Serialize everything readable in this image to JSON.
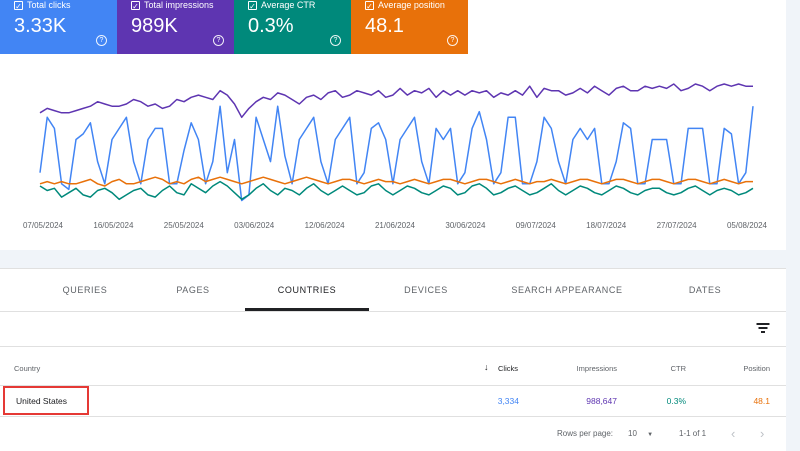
{
  "metrics": [
    {
      "label": "Total clicks",
      "value": "3.33K",
      "color": "#4285f4"
    },
    {
      "label": "Total impressions",
      "value": "989K",
      "color": "#5e35b1"
    },
    {
      "label": "Average CTR",
      "value": "0.3%",
      "color": "#00897b"
    },
    {
      "label": "Average position",
      "value": "48.1",
      "color": "#e8710a"
    }
  ],
  "chart_data": {
    "type": "line",
    "x_tick_labels": [
      "07/05/2024",
      "16/05/2024",
      "25/05/2024",
      "03/06/2024",
      "12/06/2024",
      "21/06/2024",
      "30/06/2024",
      "09/07/2024",
      "18/07/2024",
      "27/07/2024",
      "05/08/2024"
    ],
    "series": [
      {
        "name": "Total impressions",
        "color": "#5e35b1",
        "values": [
          84,
          88,
          86,
          84,
          84,
          86,
          88,
          90,
          94,
          92,
          90,
          90,
          92,
          96,
          94,
          90,
          92,
          88,
          90,
          96,
          94,
          98,
          100,
          98,
          96,
          104,
          100,
          92,
          80,
          88,
          94,
          98,
          96,
          102,
          100,
          96,
          92,
          98,
          100,
          96,
          102,
          104,
          98,
          100,
          104,
          102,
          100,
          104,
          98,
          100,
          106,
          100,
          104,
          102,
          106,
          98,
          104,
          100,
          104,
          100,
          104,
          102,
          104,
          98,
          102,
          100,
          104,
          100,
          108,
          98,
          106,
          104,
          104,
          100,
          102,
          106,
          102,
          108,
          104,
          100,
          106,
          108,
          104,
          104,
          108,
          106,
          108,
          106,
          110,
          104,
          106,
          110,
          108,
          104,
          108,
          110,
          108,
          110,
          108,
          108
        ]
      },
      {
        "name": "Total clicks",
        "color": "#4285f4",
        "values": [
          30,
          80,
          70,
          20,
          15,
          60,
          65,
          75,
          40,
          20,
          60,
          70,
          80,
          40,
          20,
          60,
          70,
          70,
          20,
          20,
          50,
          75,
          60,
          20,
          40,
          90,
          30,
          60,
          5,
          10,
          80,
          60,
          40,
          90,
          45,
          20,
          60,
          70,
          80,
          40,
          20,
          60,
          70,
          80,
          20,
          30,
          70,
          75,
          60,
          20,
          60,
          70,
          80,
          40,
          20,
          70,
          60,
          70,
          20,
          30,
          70,
          85,
          60,
          20,
          30,
          80,
          80,
          20,
          20,
          40,
          80,
          70,
          40,
          20,
          60,
          70,
          60,
          70,
          20,
          20,
          40,
          75,
          70,
          20,
          20,
          60,
          60,
          60,
          20,
          20,
          70,
          70,
          70,
          20,
          20,
          70,
          65,
          20,
          30,
          90
        ]
      },
      {
        "name": "Average position",
        "color": "#e8710a",
        "values": [
          20,
          22,
          20,
          22,
          20,
          20,
          22,
          24,
          20,
          18,
          22,
          24,
          20,
          20,
          22,
          24,
          26,
          24,
          20,
          22,
          20,
          24,
          26,
          22,
          24,
          26,
          24,
          22,
          20,
          22,
          24,
          26,
          24,
          22,
          20,
          22,
          24,
          26,
          24,
          22,
          20,
          22,
          24,
          24,
          22,
          20,
          22,
          24,
          22,
          22,
          20,
          22,
          24,
          22,
          20,
          22,
          24,
          24,
          22,
          20,
          22,
          24,
          24,
          22,
          20,
          22,
          24,
          22,
          20,
          22,
          22,
          24,
          22,
          20,
          22,
          24,
          24,
          22,
          20,
          22,
          24,
          24,
          22,
          20,
          22,
          24,
          24,
          22,
          20,
          22,
          24,
          24,
          22,
          20,
          22,
          24,
          22,
          20,
          22,
          22
        ]
      },
      {
        "name": "Average CTR",
        "color": "#00897b",
        "values": [
          18,
          14,
          16,
          8,
          12,
          16,
          10,
          8,
          14,
          16,
          12,
          6,
          10,
          14,
          16,
          10,
          8,
          14,
          18,
          12,
          10,
          20,
          16,
          12,
          18,
          22,
          18,
          12,
          6,
          10,
          16,
          20,
          14,
          10,
          16,
          14,
          10,
          16,
          20,
          14,
          10,
          14,
          18,
          14,
          10,
          12,
          18,
          20,
          14,
          10,
          14,
          18,
          16,
          12,
          10,
          14,
          18,
          16,
          10,
          12,
          18,
          20,
          16,
          10,
          12,
          16,
          18,
          14,
          10,
          12,
          16,
          20,
          14,
          10,
          14,
          18,
          16,
          12,
          10,
          14,
          18,
          16,
          12,
          10,
          14,
          16,
          16,
          12,
          10,
          12,
          16,
          18,
          14,
          10,
          14,
          16,
          14,
          10,
          12,
          16
        ]
      }
    ]
  },
  "tabs": [
    "QUERIES",
    "PAGES",
    "COUNTRIES",
    "DEVICES",
    "SEARCH APPEARANCE",
    "DATES"
  ],
  "table": {
    "headers": {
      "country": "Country",
      "clicks": "Clicks",
      "impressions": "Impressions",
      "ctr": "CTR",
      "position": "Position"
    },
    "rows": [
      {
        "country": "United States",
        "clicks": "3,334",
        "impressions": "988,647",
        "ctr": "0.3%",
        "position": "48.1"
      }
    ]
  },
  "pager": {
    "rows_per_page_label": "Rows per page:",
    "rows_per_page": "10",
    "range": "1-1 of 1"
  }
}
